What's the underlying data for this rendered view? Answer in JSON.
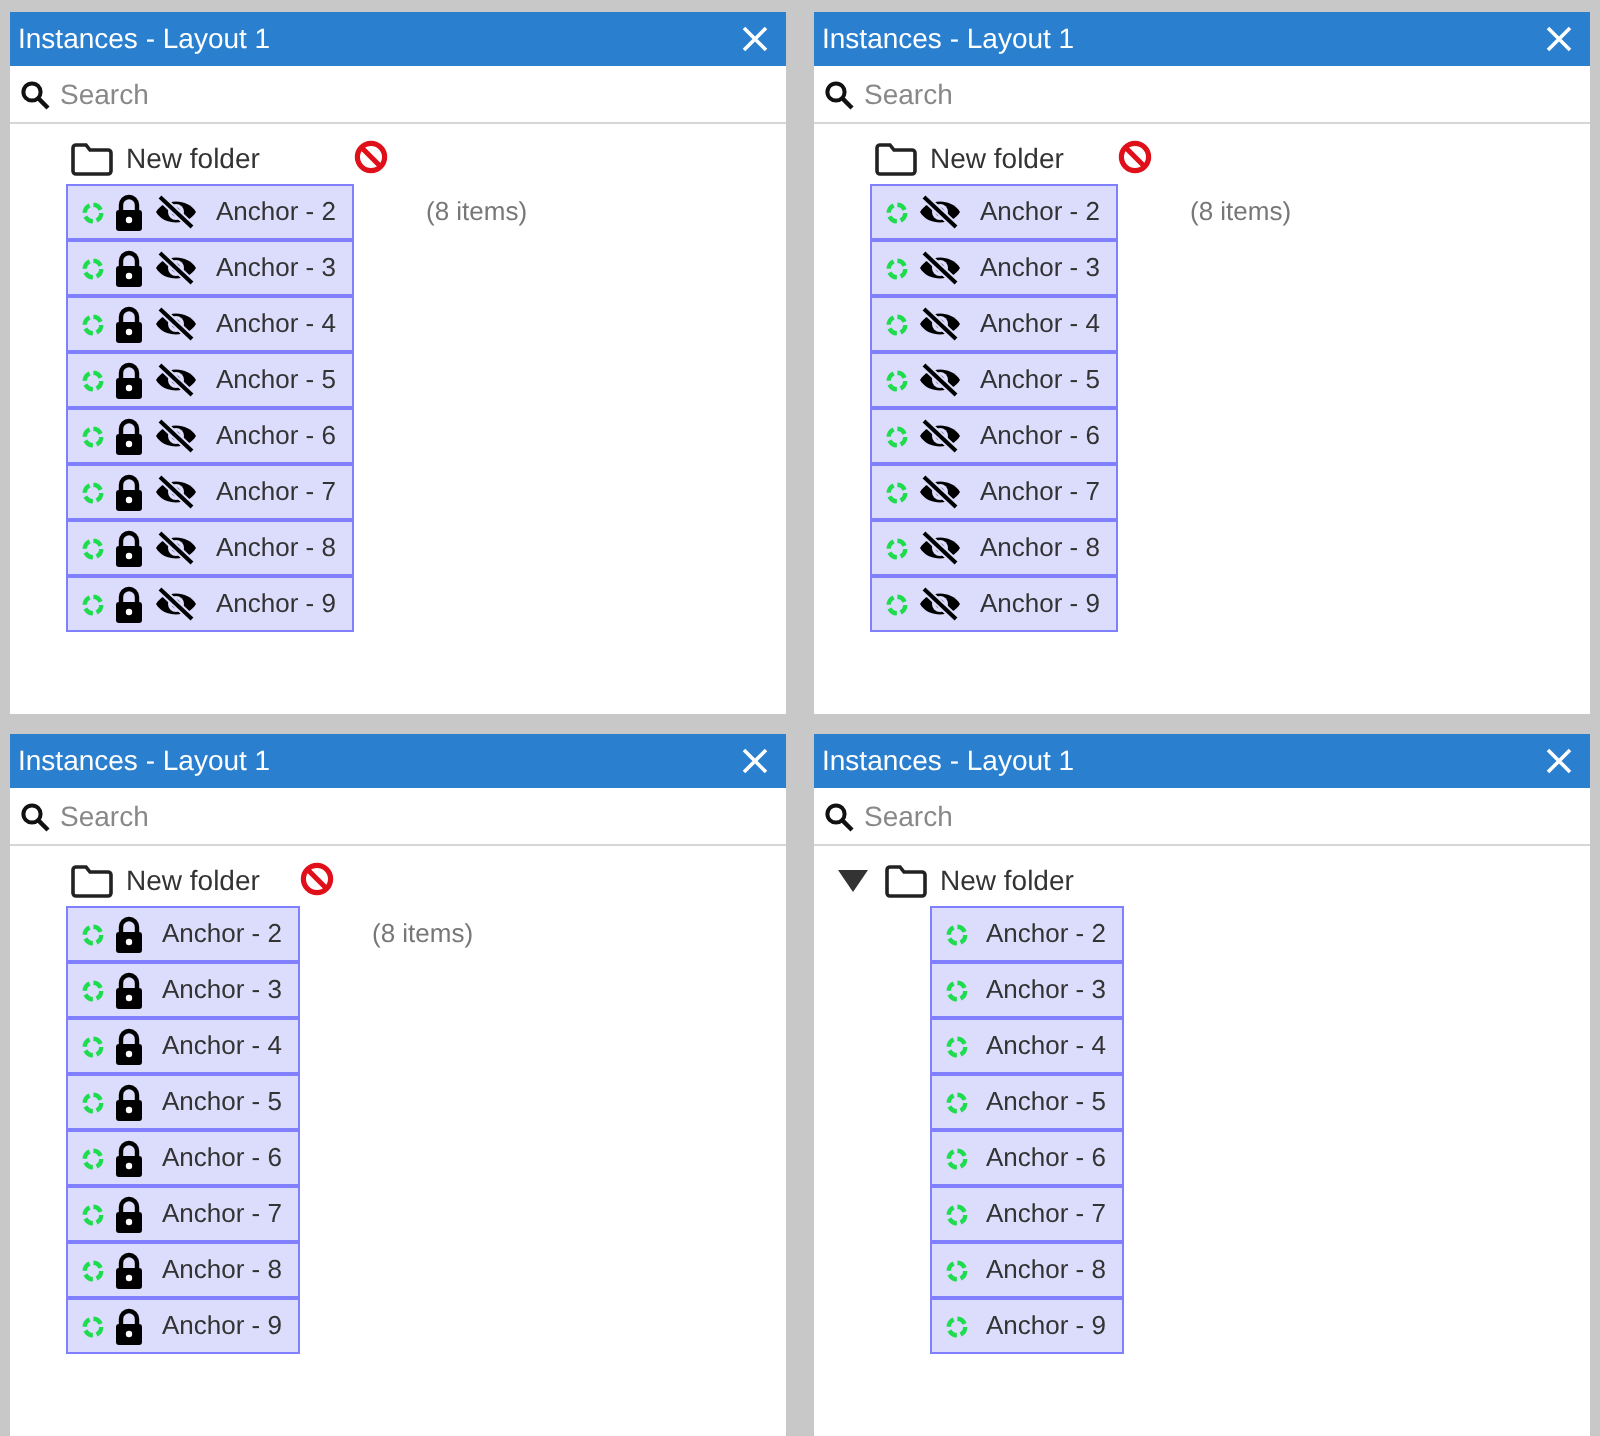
{
  "panels": [
    {
      "title": "Instances - Layout 1",
      "search": {
        "placeholder": "Search"
      },
      "folder": {
        "label": "New folder",
        "expanded": false,
        "blocked": true,
        "count": "(8 items)"
      },
      "items": [
        {
          "label": "Anchor - 2",
          "locked": true,
          "hidden": true
        },
        {
          "label": "Anchor - 3",
          "locked": true,
          "hidden": true
        },
        {
          "label": "Anchor - 4",
          "locked": true,
          "hidden": true
        },
        {
          "label": "Anchor - 5",
          "locked": true,
          "hidden": true
        },
        {
          "label": "Anchor - 6",
          "locked": true,
          "hidden": true
        },
        {
          "label": "Anchor - 7",
          "locked": true,
          "hidden": true
        },
        {
          "label": "Anchor - 8",
          "locked": true,
          "hidden": true
        },
        {
          "label": "Anchor - 9",
          "locked": true,
          "hidden": true
        }
      ]
    },
    {
      "title": "Instances - Layout 1",
      "search": {
        "placeholder": "Search"
      },
      "folder": {
        "label": "New folder",
        "expanded": false,
        "blocked": true,
        "count": "(8 items)"
      },
      "items": [
        {
          "label": "Anchor - 2",
          "locked": false,
          "hidden": true
        },
        {
          "label": "Anchor - 3",
          "locked": false,
          "hidden": true
        },
        {
          "label": "Anchor - 4",
          "locked": false,
          "hidden": true
        },
        {
          "label": "Anchor - 5",
          "locked": false,
          "hidden": true
        },
        {
          "label": "Anchor - 6",
          "locked": false,
          "hidden": true
        },
        {
          "label": "Anchor - 7",
          "locked": false,
          "hidden": true
        },
        {
          "label": "Anchor - 8",
          "locked": false,
          "hidden": true
        },
        {
          "label": "Anchor - 9",
          "locked": false,
          "hidden": true
        }
      ]
    },
    {
      "title": "Instances - Layout 1",
      "search": {
        "placeholder": "Search"
      },
      "folder": {
        "label": "New folder",
        "expanded": false,
        "blocked": true,
        "count": "(8 items)"
      },
      "items": [
        {
          "label": "Anchor - 2",
          "locked": true,
          "hidden": false
        },
        {
          "label": "Anchor - 3",
          "locked": true,
          "hidden": false
        },
        {
          "label": "Anchor - 4",
          "locked": true,
          "hidden": false
        },
        {
          "label": "Anchor - 5",
          "locked": true,
          "hidden": false
        },
        {
          "label": "Anchor - 6",
          "locked": true,
          "hidden": false
        },
        {
          "label": "Anchor - 7",
          "locked": true,
          "hidden": false
        },
        {
          "label": "Anchor - 8",
          "locked": true,
          "hidden": false
        },
        {
          "label": "Anchor - 9",
          "locked": true,
          "hidden": false
        }
      ]
    },
    {
      "title": "Instances - Layout 1",
      "search": {
        "placeholder": "Search"
      },
      "folder": {
        "label": "New folder",
        "expanded": true,
        "blocked": false
      },
      "items": [
        {
          "label": "Anchor - 2",
          "locked": false,
          "hidden": false
        },
        {
          "label": "Anchor - 3",
          "locked": false,
          "hidden": false
        },
        {
          "label": "Anchor - 4",
          "locked": false,
          "hidden": false
        },
        {
          "label": "Anchor - 5",
          "locked": false,
          "hidden": false
        },
        {
          "label": "Anchor - 6",
          "locked": false,
          "hidden": false
        },
        {
          "label": "Anchor - 7",
          "locked": false,
          "hidden": false
        },
        {
          "label": "Anchor - 8",
          "locked": false,
          "hidden": false
        },
        {
          "label": "Anchor - 9",
          "locked": false,
          "hidden": false
        }
      ]
    }
  ]
}
